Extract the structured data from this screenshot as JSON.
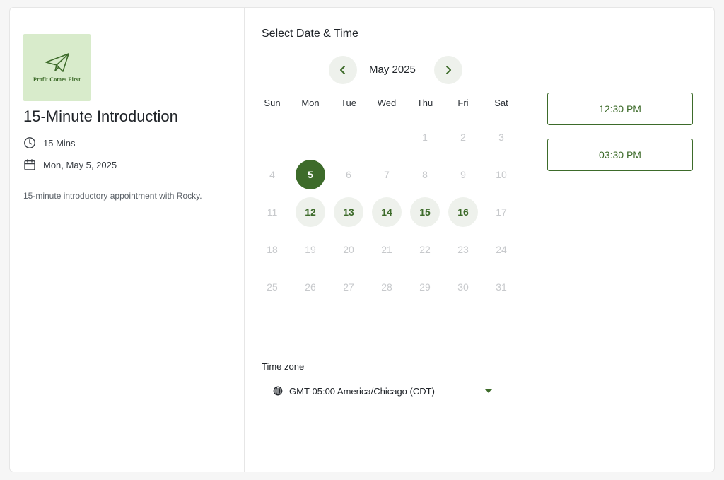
{
  "event": {
    "logo_text": "Profit Comes First",
    "title": "15-Minute Introduction",
    "duration": "15 Mins",
    "date": "Mon, May 5, 2025",
    "description": "15-minute introductory appointment with Rocky."
  },
  "calendar": {
    "heading": "Select Date & Time",
    "month": "May 2025",
    "weekdays": [
      "Sun",
      "Mon",
      "Tue",
      "Wed",
      "Thu",
      "Fri",
      "Sat"
    ],
    "first_weekday_index": 4,
    "days_in_month": 31,
    "selected_day": 5,
    "available_days": [
      12,
      13,
      14,
      15,
      16
    ]
  },
  "time_slots": [
    "12:30 PM",
    "03:30 PM"
  ],
  "timezone": {
    "label": "Time zone",
    "value": "GMT-05:00 America/Chicago (CDT)"
  },
  "colors": {
    "accent": "#3d6b2a",
    "accent_light": "#eef1ec",
    "logo_bg": "#d8ebcb"
  }
}
